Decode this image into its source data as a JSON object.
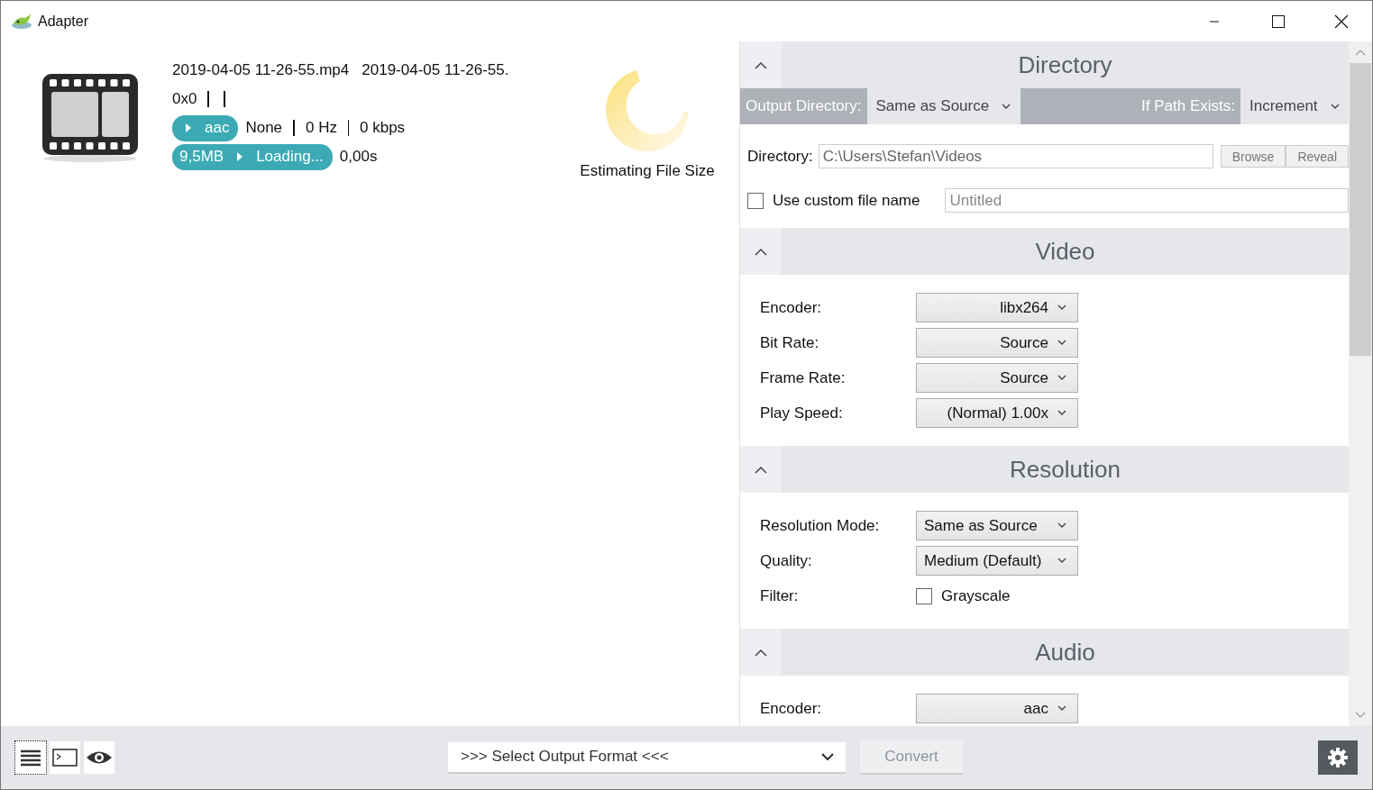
{
  "window": {
    "title": "Adapter"
  },
  "file": {
    "names": [
      "2019-04-05 11-26-55.mp4",
      "2019-04-05 11-26-55."
    ],
    "resolution": "0x0",
    "audio_codec": "aac",
    "channels": "None",
    "sample_rate": "0 Hz",
    "bitrate": "0 kbps",
    "size": "9,5MB",
    "status": "Loading...",
    "duration": "0,00s"
  },
  "estimate": {
    "label": "Estimating File Size"
  },
  "sections": [
    {
      "kind": "directory",
      "title": "Directory",
      "expanded": true,
      "output_label": "Output Directory:",
      "output_value": "Same as Source",
      "exists_label": "If Path Exists:",
      "exists_value": "Increment",
      "dir_label": "Directory:",
      "dir_value": "C:\\Users\\Stefan\\Videos",
      "buttons": [
        "Browse",
        "Reveal"
      ],
      "custom_label": "Use custom file name",
      "custom_checked": false,
      "custom_placeholder": "Untitled"
    },
    {
      "kind": "form",
      "title": "Video",
      "expanded": true,
      "rows": [
        {
          "kind": "select",
          "label": "Encoder:",
          "value": "libx264"
        },
        {
          "kind": "select",
          "label": "Bit Rate:",
          "value": "Source"
        },
        {
          "kind": "select",
          "label": "Frame Rate:",
          "value": "Source"
        },
        {
          "kind": "select",
          "label": "Play Speed:",
          "value": "(Normal) 1.00x"
        }
      ]
    },
    {
      "kind": "form",
      "title": "Resolution",
      "expanded": true,
      "rows": [
        {
          "kind": "combo",
          "label": "Resolution Mode:",
          "value": "Same as Source"
        },
        {
          "kind": "combo",
          "label": "Quality:",
          "value": "Medium (Default)"
        },
        {
          "kind": "checkbox",
          "label": "Filter:",
          "value": "Grayscale",
          "checked": false
        }
      ]
    },
    {
      "kind": "form",
      "title": "Audio",
      "expanded": true,
      "rows": [
        {
          "kind": "select",
          "label": "Encoder:",
          "value": "aac"
        }
      ]
    }
  ],
  "bottom": {
    "format_placeholder": ">>> Select Output Format <<<",
    "convert": {
      "label": "Convert",
      "disabled": true
    }
  }
}
